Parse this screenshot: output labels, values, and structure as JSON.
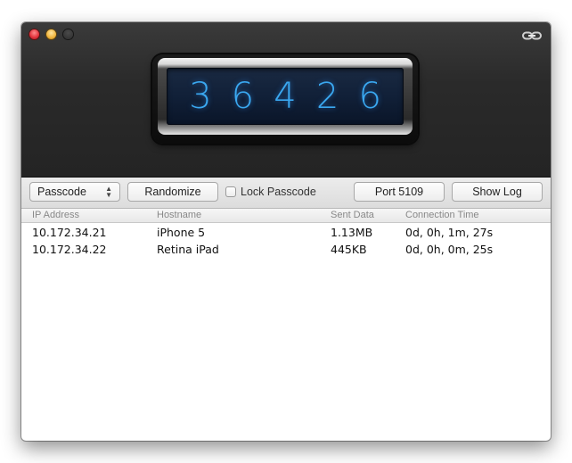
{
  "window": {
    "traffic_lights": [
      "close",
      "minimize",
      "zoom"
    ],
    "corner_icon": "link-chain-icon"
  },
  "display": {
    "digits": [
      "3",
      "6",
      "4",
      "2",
      "6"
    ],
    "digit_color": "#3aa8f0"
  },
  "toolbar": {
    "mode_select_value": "Passcode",
    "randomize_label": "Randomize",
    "lock_label": "Lock Passcode",
    "lock_checked": false,
    "port_label": "Port 5109",
    "show_log_label": "Show Log"
  },
  "table": {
    "columns": [
      "IP Address",
      "Hostname",
      "Sent Data",
      "Connection Time"
    ],
    "rows": [
      [
        "10.172.34.21",
        "iPhone 5",
        "1.13MB",
        "0d, 0h, 1m, 27s"
      ],
      [
        "10.172.34.22",
        "Retina iPad",
        "445KB",
        "0d, 0h, 0m, 25s"
      ]
    ]
  }
}
